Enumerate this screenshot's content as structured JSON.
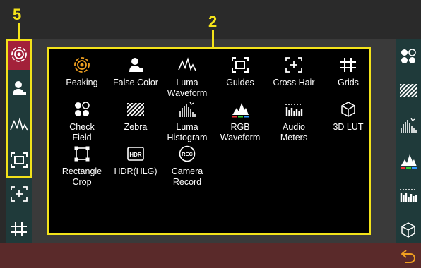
{
  "callouts": {
    "left": "5",
    "panel": "2"
  },
  "colors": {
    "accent_yellow": "#f3e21a",
    "active_red": "#a3213a",
    "sidebar": "#1f3a3a",
    "bottom_bar": "#5a2a2a",
    "peaking_orange": "#f0a020"
  },
  "left_sidebar": {
    "items": [
      {
        "icon": "peaking-icon",
        "active": true
      },
      {
        "icon": "false-color-icon",
        "active": false
      },
      {
        "icon": "luma-waveform-icon",
        "active": false
      },
      {
        "icon": "guides-icon",
        "active": false
      },
      {
        "icon": "cross-hair-icon",
        "active": false
      },
      {
        "icon": "grids-icon",
        "active": false
      }
    ]
  },
  "tools": [
    {
      "label": "Peaking",
      "icon": "peaking-icon"
    },
    {
      "label": "False Color",
      "icon": "false-color-icon"
    },
    {
      "label": "Luma\nWaveform",
      "icon": "luma-waveform-icon"
    },
    {
      "label": "Guides",
      "icon": "guides-icon"
    },
    {
      "label": "Cross Hair",
      "icon": "cross-hair-icon"
    },
    {
      "label": "Grids",
      "icon": "grids-icon"
    },
    {
      "label": "Check\nField",
      "icon": "check-field-icon"
    },
    {
      "label": "Zebra",
      "icon": "zebra-icon"
    },
    {
      "label": "Luma\nHistogram",
      "icon": "luma-histogram-icon"
    },
    {
      "label": "RGB\nWaveform",
      "icon": "rgb-waveform-icon"
    },
    {
      "label": "Audio\nMeters",
      "icon": "audio-meters-icon"
    },
    {
      "label": "3D LUT",
      "icon": "3d-lut-icon"
    },
    {
      "label": "Rectangle\nCrop",
      "icon": "rectangle-crop-icon"
    },
    {
      "label": "HDR(HLG)",
      "icon": "hdr-icon"
    },
    {
      "label": "Camera\nRecord",
      "icon": "camera-record-icon"
    }
  ],
  "icon_text": {
    "hdr": "HDR",
    "rec": "REC"
  },
  "right_sidebar": {
    "items": [
      {
        "icon": "check-field-icon"
      },
      {
        "icon": "zebra-icon"
      },
      {
        "icon": "luma-histogram-icon"
      },
      {
        "icon": "rgb-waveform-icon"
      },
      {
        "icon": "audio-meters-icon"
      },
      {
        "icon": "3d-lut-icon"
      }
    ]
  },
  "bottom_bar": {
    "back_icon": "back-arrow-icon"
  }
}
